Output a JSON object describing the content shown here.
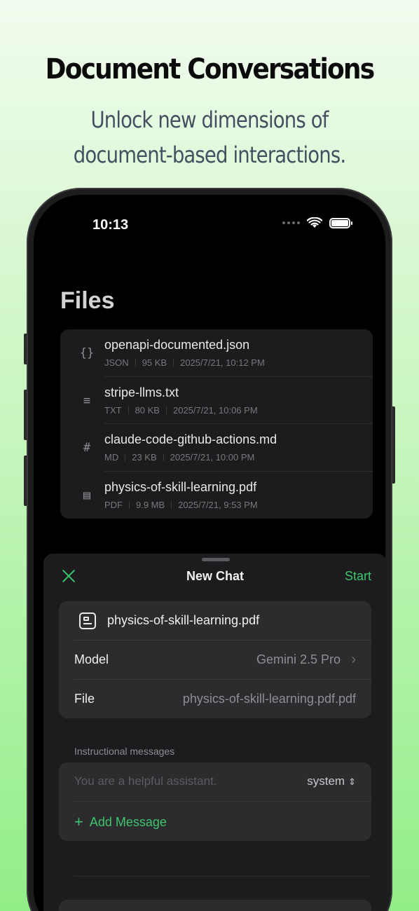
{
  "promo": {
    "headline": "Document Conversations",
    "subheadline_line1": "Unlock new dimensions of",
    "subheadline_line2": "document-based interactions."
  },
  "status_bar": {
    "time": "10:13"
  },
  "files_screen": {
    "title": "Files",
    "files": [
      {
        "icon": "json-braces-icon",
        "glyph": "{}",
        "name": "openapi-documented.json",
        "type": "JSON",
        "size": "95 KB",
        "date": "2025/7/21, 10:12 PM"
      },
      {
        "icon": "text-lines-icon",
        "glyph": "≡",
        "name": "stripe-llms.txt",
        "type": "TXT",
        "size": "80 KB",
        "date": "2025/7/21, 10:06 PM"
      },
      {
        "icon": "markdown-hash-icon",
        "glyph": "#",
        "name": "claude-code-github-actions.md",
        "type": "MD",
        "size": "23 KB",
        "date": "2025/7/21, 10:00 PM"
      },
      {
        "icon": "pdf-doc-icon",
        "glyph": "▤",
        "name": "physics-of-skill-learning.pdf",
        "type": "PDF",
        "size": "9.9 MB",
        "date": "2025/7/21, 9:53 PM"
      }
    ]
  },
  "new_chat_sheet": {
    "title": "New Chat",
    "start_label": "Start",
    "selected_file": "physics-of-skill-learning.pdf",
    "model_label": "Model",
    "model_value": "Gemini 2.5 Pro",
    "file_label": "File",
    "file_value": "physics-of-skill-learning.pdf.pdf",
    "instructional_section_label": "Instructional messages",
    "system_placeholder": "You are a helpful assistant.",
    "role_value": "system",
    "add_message_label": "Add Message",
    "accent_color": "#3ec46d"
  }
}
